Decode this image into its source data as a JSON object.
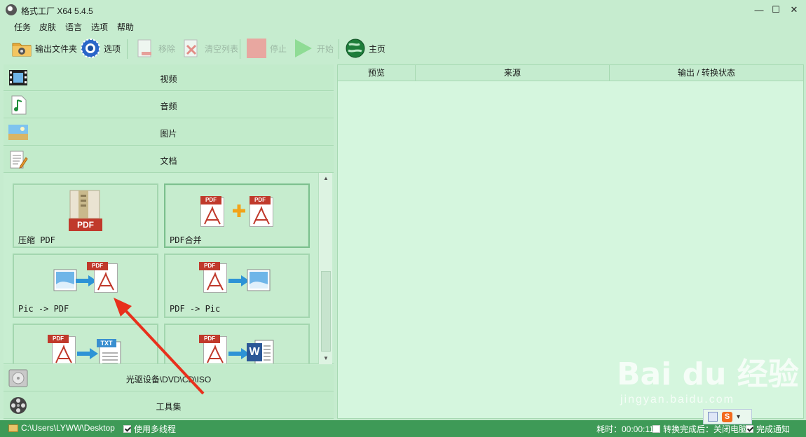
{
  "window": {
    "title": "格式工厂 X64 5.4.5",
    "min": "—",
    "max": "☐",
    "close": "✕"
  },
  "menu": [
    "任务",
    "皮肤",
    "语言",
    "选项",
    "帮助"
  ],
  "toolbar": {
    "output_folder": "输出文件夹",
    "options": "选项",
    "remove": "移除",
    "clear_list": "清空列表",
    "stop": "停止",
    "start": "开始",
    "home": "主页"
  },
  "categories": {
    "video": "视频",
    "audio": "音频",
    "image": "图片",
    "document": "文档",
    "disc": "光驱设备\\DVD\\CD\\ISO",
    "tools": "工具集"
  },
  "tiles": {
    "compress_pdf": "压缩 PDF",
    "pdf_merge": "PDF合并",
    "pic_to_pdf": "Pic -> PDF",
    "pdf_to_pic": "PDF -> Pic",
    "pdf_tag": "PDF",
    "txt_tag": "TXT",
    "word_letter": "W"
  },
  "table": {
    "headers": [
      "预览",
      "来源",
      "输出 / 转换状态"
    ]
  },
  "status": {
    "path": "C:\\Users\\LYWW\\Desktop",
    "multithread_label": "使用多线程",
    "multithread_checked": true,
    "elapsed_label": "耗时：00:00:11",
    "after_label": "转换完成后：关闭电脑",
    "after_checked": false,
    "notify_label": "完成通知",
    "notify_checked": true
  },
  "watermark": {
    "main": "Bai du 经验",
    "sub": "jingyan.baidu.com"
  },
  "colors": {
    "background": "#c6eccf",
    "statusbar": "#3e9a57",
    "annotation_arrow": "#e8301c",
    "pdf_red": "#c0392b"
  }
}
